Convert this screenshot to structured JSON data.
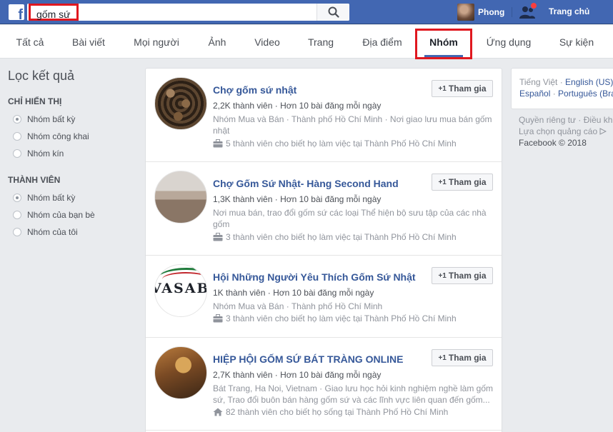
{
  "topbar": {
    "logo": "f",
    "search_value": "gốm sứ",
    "user_name": "Phong",
    "home_label": "Trang chủ"
  },
  "tabs": [
    {
      "label": "Tất cả"
    },
    {
      "label": "Bài viết"
    },
    {
      "label": "Mọi người"
    },
    {
      "label": "Ảnh"
    },
    {
      "label": "Video"
    },
    {
      "label": "Trang"
    },
    {
      "label": "Địa điểm"
    },
    {
      "label": "Nhóm"
    },
    {
      "label": "Ứng dụng"
    },
    {
      "label": "Sự kiện"
    }
  ],
  "active_tab": "Nhóm",
  "filters": {
    "title": "Lọc kết quả",
    "show_only": {
      "title": "CHỈ HIỂN THỊ",
      "options": [
        "Nhóm bất kỳ",
        "Nhóm công khai",
        "Nhóm kín"
      ]
    },
    "members": {
      "title": "THÀNH VIÊN",
      "options": [
        "Nhóm bất kỳ",
        "Nhóm của bạn bè",
        "Nhóm của tôi"
      ]
    }
  },
  "results": [
    {
      "title": "Chợ gốm sứ nhật",
      "members": "2,2K thành viên",
      "posts": "Hơn 10 bài đăng mỗi ngày",
      "desc": "Nhóm Mua và Bán · Thành phố Hồ Chí Minh · Nơi giao lưu mua bán gốm nhật",
      "work": "5 thành viên cho biết họ làm việc tại Thành Phố Hồ Chí Minh",
      "join": "Tham gia"
    },
    {
      "title": "Chợ Gốm Sứ Nhật- Hàng Second Hand",
      "members": "1,3K thành viên",
      "posts": "Hơn 10 bài đăng mỗi ngày",
      "desc": "Nơi mua bán, trao đổi gốm sứ các loại Thể hiện bộ sưu tập của các nhà gốm",
      "work": "3 thành viên cho biết họ làm việc tại Thành Phố Hồ Chí Minh",
      "join": "Tham gia"
    },
    {
      "title": "Hội Những Người Yêu Thích Gốm Sứ Nhật",
      "members": "1K thành viên",
      "posts": "Hơn 10 bài đăng mỗi ngày",
      "desc": "Nhóm Mua và Bán · Thành phố Hồ Chí Minh",
      "work": "3 thành viên cho biết họ làm việc tại Thành Phố Hồ Chí Minh",
      "join": "Tham gia",
      "logo_text": "VASABI"
    },
    {
      "title": "HIỆP HỘI GỐM SỨ BÁT TRÀNG ONLINE",
      "members": "2,7K thành viên",
      "posts": "Hơn 10 bài đăng mỗi ngày",
      "desc": "Bát Trang, Ha Noi, Vietnam · Giao lưu học hỏi kinh nghiệm nghề làm gốm sứ, Trao đổi buôn bán hàng gốm sứ và các lĩnh vực liên quan đến gốm...",
      "work": "82 thành viên cho biết họ sống tại Thành Phố Hồ Chí Minh",
      "join": "Tham gia"
    }
  ],
  "right": {
    "lang_current": "Tiếng Việt",
    "lang_1": "English (US)",
    "lang_2": "Español",
    "lang_3": "Português (Bra",
    "privacy": "Quyền riêng tư",
    "terms": "Điều kh",
    "ad_choices": "Lựa chọn quảng cáo",
    "copyright": "Facebook © 2018"
  },
  "colors": {
    "brand_blue": "#4267b2",
    "link_blue": "#365899",
    "highlight_red": "#e0181f",
    "notification_red": "#fa3e3e"
  }
}
